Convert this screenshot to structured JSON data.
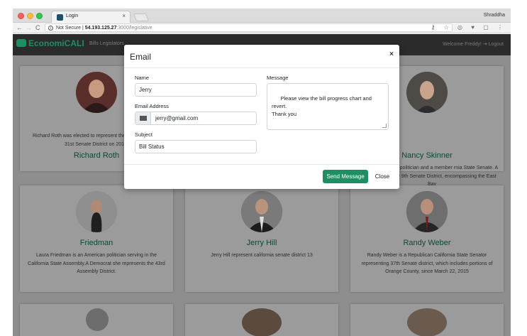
{
  "browser": {
    "tab_title": "Login",
    "tab_close": "×",
    "profile_name": "Shraddha",
    "nav_back": "←",
    "nav_forward": "→",
    "nav_reload": "C",
    "security_label": "Not Secure",
    "url_host": "54.193.125.27",
    "url_path": ":3000/legislative",
    "extension_icons": "⚷ ☆ ◎ ♥ ▢ ⋮"
  },
  "app": {
    "brand": "EconomiCALI",
    "nav_links": "Bills   Legislators",
    "welcome": "Welcome Freddy!",
    "logout": "Logout"
  },
  "cards": [
    {
      "name": "Richard Roth",
      "desc": "Richard Roth was elected to represent the State Senate's 31st Senate District on 2012"
    },
    {
      "name": "Nancy Skinner",
      "desc": "is an American politician and a member rnia State Senate. A Democrat, she 9th Senate District, encompassing the East Bay"
    },
    {
      "name": "Friedman",
      "desc": "Laura Friedman is an American politician serving in the California State Assembly.A Democrat she represents the 43rd Assembly District."
    },
    {
      "name": "Jerry Hill",
      "desc": "Jerry Hill represent california senate district 13"
    },
    {
      "name": "Randy Weber",
      "desc": "Randy Weber is a Republican California State Senator representing 37th Senate district, which includes portions of Orange County, since March 22, 2015"
    }
  ],
  "modal": {
    "title": "Email",
    "close_icon": "×",
    "name_label": "Name",
    "name_value": "Jerry",
    "email_label": "Email Address",
    "email_value": "jerry@gmail.com",
    "subject_label": "Subject",
    "subject_value": "Bill Status",
    "message_label": "Message",
    "message_value": "Please view the bill progress chart and revert.\nThank you",
    "send_button": "Send Message",
    "close_button": "Close"
  },
  "colors": {
    "accent": "#1e8f63",
    "navbar": "#2b2b2b",
    "overlay": "#8e8e8e"
  }
}
